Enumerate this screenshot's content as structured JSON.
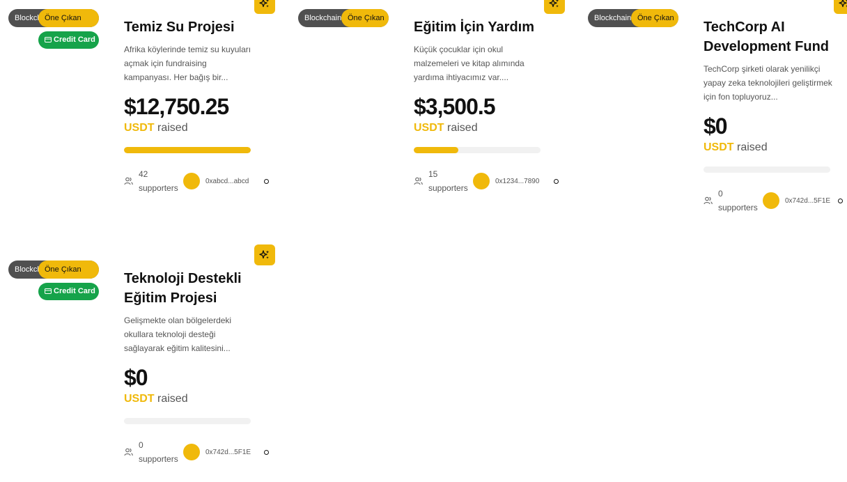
{
  "labels": {
    "blockchain": "Blockchain",
    "featured": "Öne Çıkan",
    "credit_card": "Credit Card",
    "currency": "USDT",
    "raised": "raised",
    "supporters": "supporters"
  },
  "cards": [
    {
      "title": "Temiz Su Projesi",
      "description": "Afrika köylerinde temiz su kuyuları açmak için fundraising kampanyası. Her bağış bir...",
      "amount": "$12,750.25",
      "progress_percent": 100,
      "supporters_count": "42",
      "address": "0xabcd...abcd",
      "credit_card": true
    },
    {
      "title": "Eğitim İçin Yardım",
      "description": "Küçük çocuklar için okul malzemeleri ve kitap alımında yardıma ihtiyacımız var....",
      "amount": "$3,500.5",
      "progress_percent": 35,
      "supporters_count": "15",
      "address": "0x1234...7890",
      "credit_card": false
    },
    {
      "title": "TechCorp AI Development Fund",
      "description": "TechCorp şirketi olarak yenilikçi yapay zeka teknolojileri geliştirmek için fon topluyoruz...",
      "amount": "$0",
      "progress_percent": 0,
      "supporters_count": "0",
      "address": "0x742d...5F1E",
      "credit_card": false
    },
    {
      "title": "Teknoloji Destekli Eğitim Projesi",
      "description": "Gelişmekte olan bölgelerdeki okullara teknoloji desteği sağlayarak eğitim kalitesini...",
      "amount": "$0",
      "progress_percent": 0,
      "supporters_count": "0",
      "address": "0x742d...5F1E",
      "credit_card": true
    }
  ],
  "colors": {
    "accent": "#f0b90b",
    "blockchain_badge": "#505050",
    "credit_card_badge": "#16a34a"
  },
  "icons": {
    "featured": "sparkles-icon",
    "credit_card": "credit-card-icon",
    "supporters": "users-icon"
  }
}
